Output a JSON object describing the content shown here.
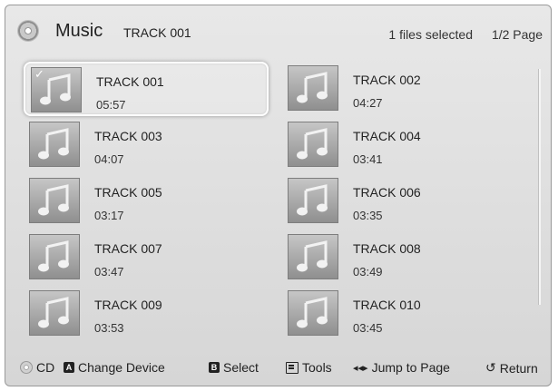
{
  "header": {
    "title": "Music",
    "current_track": "TRACK 001",
    "selected_count": "1 files selected",
    "page_indicator": "1/2 Page"
  },
  "tracks": [
    {
      "name": "TRACK 001",
      "duration": "05:57",
      "selected": true,
      "focused": true
    },
    {
      "name": "TRACK 002",
      "duration": "04:27",
      "selected": false,
      "focused": false
    },
    {
      "name": "TRACK 003",
      "duration": "04:07",
      "selected": false,
      "focused": false
    },
    {
      "name": "TRACK 004",
      "duration": "03:41",
      "selected": false,
      "focused": false
    },
    {
      "name": "TRACK 005",
      "duration": "03:17",
      "selected": false,
      "focused": false
    },
    {
      "name": "TRACK 006",
      "duration": "03:35",
      "selected": false,
      "focused": false
    },
    {
      "name": "TRACK 007",
      "duration": "03:47",
      "selected": false,
      "focused": false
    },
    {
      "name": "TRACK 008",
      "duration": "03:49",
      "selected": false,
      "focused": false
    },
    {
      "name": "TRACK 009",
      "duration": "03:53",
      "selected": false,
      "focused": false
    },
    {
      "name": "TRACK 010",
      "duration": "03:45",
      "selected": false,
      "focused": false
    }
  ],
  "footer": {
    "cd_label": "CD",
    "a_key": "A",
    "change_device_label": "Change Device",
    "b_key": "B",
    "select_label": "Select",
    "tools_label": "Tools",
    "jump_arrows": "◂◂▸",
    "jump_label": "Jump to Page",
    "return_symbol": "↺",
    "return_label": "Return"
  },
  "icons": {
    "thumbnail": "music-note-icon",
    "header": "disc-icon",
    "cd": "cd-icon",
    "tools": "tools-icon",
    "check": "check-icon"
  }
}
